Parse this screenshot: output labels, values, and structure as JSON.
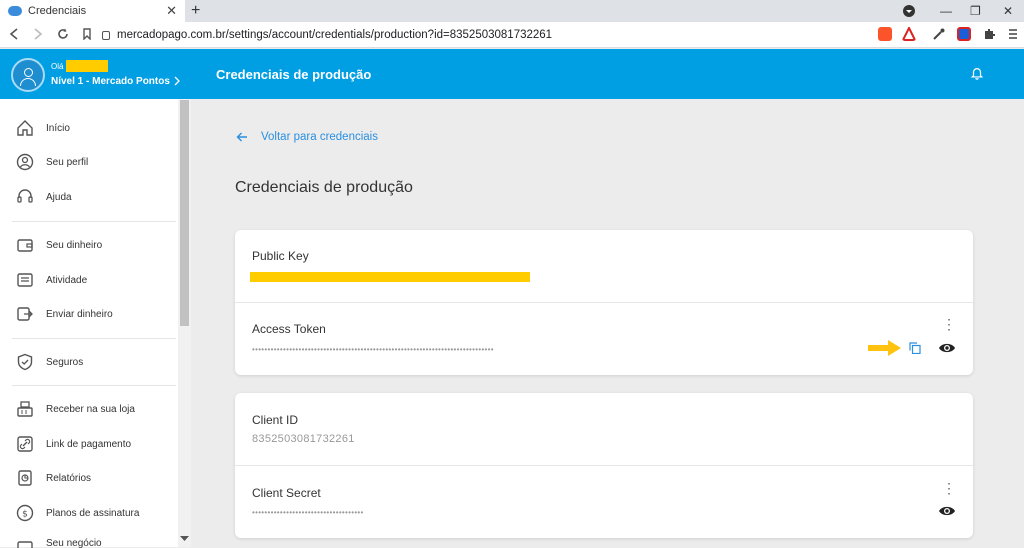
{
  "browser": {
    "tab_title": "Credenciais",
    "tab_close": "✕",
    "new_tab": "+",
    "url": "mercadopago.com.br/settings/account/credentials/production?id=8352503081732261",
    "window_controls": [
      "—",
      "❐",
      "✕"
    ]
  },
  "header": {
    "greeting": "Olá",
    "level": "Nível 1 - Mercado Pontos",
    "title": "Credenciais de produção"
  },
  "sidebar": {
    "items": [
      {
        "label": "Início",
        "icon": "home-icon"
      },
      {
        "label": "Seu perfil",
        "icon": "user-circle-icon"
      },
      {
        "label": "Ajuda",
        "icon": "headset-icon"
      },
      {
        "label": "Seu dinheiro",
        "icon": "wallet-icon"
      },
      {
        "label": "Atividade",
        "icon": "list-icon"
      },
      {
        "label": "Enviar dinheiro",
        "icon": "send-money-icon"
      },
      {
        "label": "Seguros",
        "icon": "shield-icon"
      },
      {
        "label": "Receber na sua loja",
        "icon": "cash-register-icon"
      },
      {
        "label": "Link de pagamento",
        "icon": "link-icon"
      },
      {
        "label": "Relatórios",
        "icon": "report-icon"
      },
      {
        "label": "Planos de assinatura",
        "icon": "subscription-icon"
      },
      {
        "label": "Seu negócio",
        "icon": "business-icon"
      }
    ]
  },
  "main": {
    "back_link": "Voltar para credenciais",
    "title": "Credenciais de produção",
    "card1": {
      "public_key_label": "Public Key",
      "access_token_label": "Access Token",
      "access_token_value": "••••••••••••••••••••••••••••••••••••••••••••••••••••••••••••••••••••••••••••••"
    },
    "card2": {
      "client_id_label": "Client ID",
      "client_id_value": "8352503081732261",
      "client_secret_label": "Client Secret",
      "client_secret_value": "••••••••••••••••••••••••••••••••••••"
    }
  },
  "colors": {
    "brand_blue": "#009ee3",
    "link_blue": "#2a8fe0",
    "redaction_yellow": "#ffcc00",
    "annotation_arrow": "#ffc20e"
  }
}
